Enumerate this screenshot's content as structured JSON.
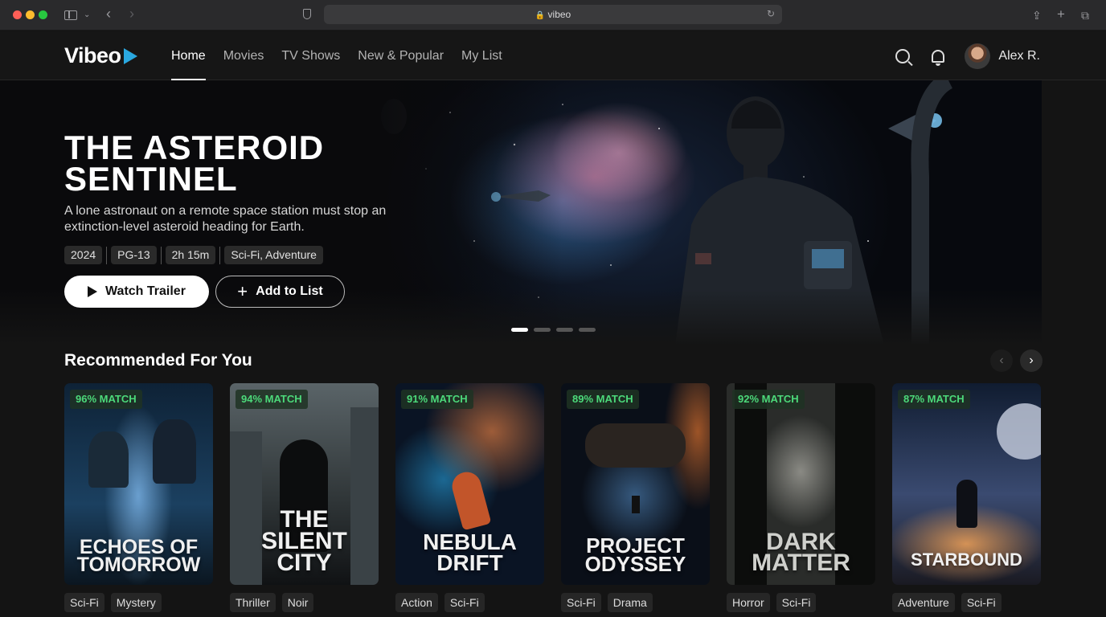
{
  "browser": {
    "url": "vibeo"
  },
  "nav": {
    "logo": "Vibeo",
    "links": [
      {
        "label": "Home",
        "active": true
      },
      {
        "label": "Movies",
        "active": false
      },
      {
        "label": "TV Shows",
        "active": false
      },
      {
        "label": "New & Popular",
        "active": false
      },
      {
        "label": "My List",
        "active": false
      }
    ],
    "user": "Alex R."
  },
  "hero": {
    "title": "THE ASTEROID SENTINEL",
    "description": "A lone astronaut on a remote space station must stop an extinction-level asteroid heading for Earth.",
    "tags": [
      "2024",
      "PG-13",
      "2h 15m",
      "Sci-Fi, Adventure"
    ],
    "watch_label": "Watch Trailer",
    "add_label": "Add to List",
    "slides": 4,
    "active_slide": 1
  },
  "recommended": {
    "title": "Recommended For You",
    "items": [
      {
        "match": "96% MATCH",
        "title": "ECHOES OF TOMORROW",
        "tags": [
          "Sci-Fi",
          "Mystery"
        ]
      },
      {
        "match": "94% MATCH",
        "title": "THE SILENT CITY",
        "tags": [
          "Thriller",
          "Noir"
        ]
      },
      {
        "match": "91% MATCH",
        "title": "NEBULA DRIFT",
        "tags": [
          "Action",
          "Sci-Fi"
        ]
      },
      {
        "match": "89% MATCH",
        "title": "PROJECT ODYSSEY",
        "tags": [
          "Sci-Fi",
          "Drama"
        ]
      },
      {
        "match": "92% MATCH",
        "title": "DARK MATTER",
        "tags": [
          "Horror",
          "Sci-Fi"
        ]
      },
      {
        "match": "87% MATCH",
        "title": "STARBOUND",
        "tags": [
          "Adventure",
          "Sci-Fi"
        ]
      }
    ]
  },
  "colors": {
    "match_green": "#4cd97a",
    "accent": "#2aa8e0"
  }
}
